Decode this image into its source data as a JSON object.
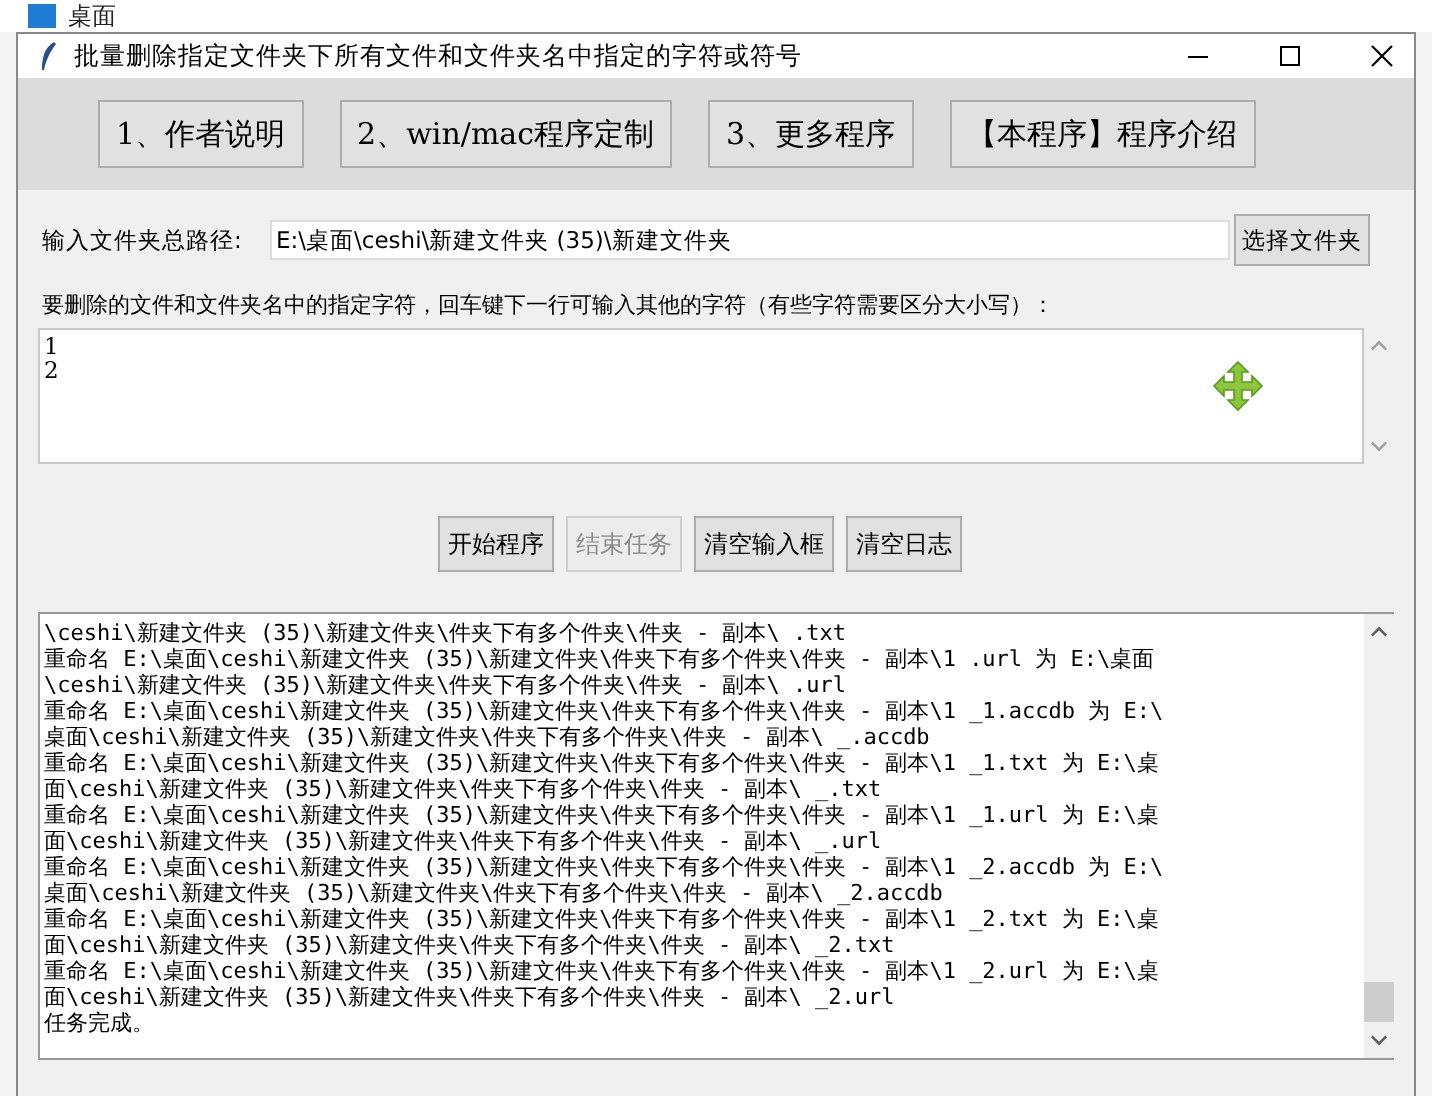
{
  "desktop": {
    "label": "桌面"
  },
  "window": {
    "title": "批量删除指定文件夹下所有文件和文件夹名中指定的字符或符号"
  },
  "toolbar": {
    "buttons": [
      "1、作者说明",
      "2、win/mac程序定制",
      "3、更多程序",
      "【本程序】程序介绍"
    ]
  },
  "path": {
    "label": "输入文件夹总路径:",
    "value": "E:\\桌面\\ceshi\\新建文件夹 (35)\\新建文件夹",
    "button": "选择文件夹"
  },
  "characters": {
    "label": "要删除的文件和文件夹名中的指定字符，回车键下一行可输入其他的字符（有些字符需要区分大小写）：",
    "lines": [
      "1",
      "2"
    ]
  },
  "actions": [
    {
      "label": "开始程序",
      "disabled": false
    },
    {
      "label": "结束任务",
      "disabled": true
    },
    {
      "label": "清空输入框",
      "disabled": false
    },
    {
      "label": "清空日志",
      "disabled": false
    }
  ],
  "log": {
    "lines": [
      "\\ceshi\\新建文件夹 (35)\\新建文件夹\\件夹下有多个件夹\\件夹 - 副本\\ .txt",
      "重命名 E:\\桌面\\ceshi\\新建文件夹 (35)\\新建文件夹\\件夹下有多个件夹\\件夹 - 副本\\1 .url 为 E:\\桌面",
      "\\ceshi\\新建文件夹 (35)\\新建文件夹\\件夹下有多个件夹\\件夹 - 副本\\ .url",
      "重命名 E:\\桌面\\ceshi\\新建文件夹 (35)\\新建文件夹\\件夹下有多个件夹\\件夹 - 副本\\1 _1.accdb 为 E:\\",
      "桌面\\ceshi\\新建文件夹 (35)\\新建文件夹\\件夹下有多个件夹\\件夹 - 副本\\ _.accdb",
      "重命名 E:\\桌面\\ceshi\\新建文件夹 (35)\\新建文件夹\\件夹下有多个件夹\\件夹 - 副本\\1 _1.txt 为 E:\\桌",
      "面\\ceshi\\新建文件夹 (35)\\新建文件夹\\件夹下有多个件夹\\件夹 - 副本\\ _.txt",
      "重命名 E:\\桌面\\ceshi\\新建文件夹 (35)\\新建文件夹\\件夹下有多个件夹\\件夹 - 副本\\1 _1.url 为 E:\\桌",
      "面\\ceshi\\新建文件夹 (35)\\新建文件夹\\件夹下有多个件夹\\件夹 - 副本\\ _.url",
      "重命名 E:\\桌面\\ceshi\\新建文件夹 (35)\\新建文件夹\\件夹下有多个件夹\\件夹 - 副本\\1 _2.accdb 为 E:\\",
      "桌面\\ceshi\\新建文件夹 (35)\\新建文件夹\\件夹下有多个件夹\\件夹 - 副本\\ _2.accdb",
      "重命名 E:\\桌面\\ceshi\\新建文件夹 (35)\\新建文件夹\\件夹下有多个件夹\\件夹 - 副本\\1 _2.txt 为 E:\\桌",
      "面\\ceshi\\新建文件夹 (35)\\新建文件夹\\件夹下有多个件夹\\件夹 - 副本\\ _2.txt",
      "重命名 E:\\桌面\\ceshi\\新建文件夹 (35)\\新建文件夹\\件夹下有多个件夹\\件夹 - 副本\\1 _2.url 为 E:\\桌",
      "面\\ceshi\\新建文件夹 (35)\\新建文件夹\\件夹下有多个件夹\\件夹 - 副本\\ _2.url",
      "任务完成。"
    ]
  }
}
